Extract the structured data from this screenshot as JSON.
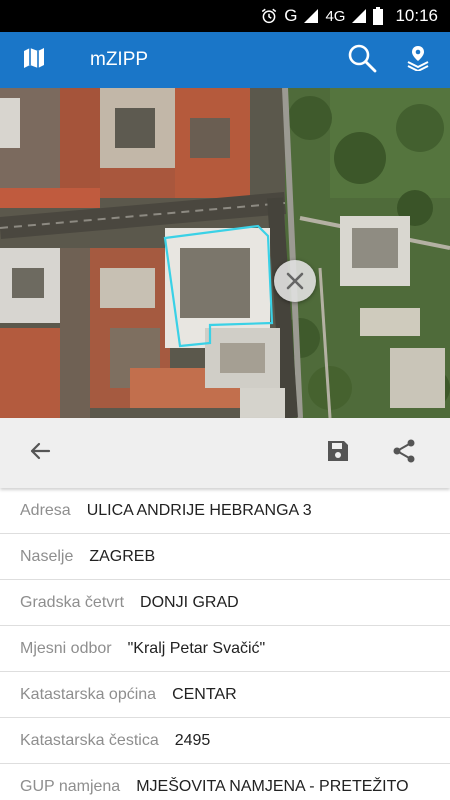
{
  "status_bar": {
    "network_label": "G",
    "network_type": "4G",
    "time": "10:16"
  },
  "app_bar": {
    "title": "mZIPP",
    "color": "#1a76c8",
    "icons": [
      "map-icon",
      "search-icon",
      "location-layers-icon"
    ]
  },
  "map": {
    "highlight_color": "#3ad1e6"
  },
  "toolbar": {
    "icons": [
      "back-arrow-icon",
      "save-icon",
      "share-icon"
    ]
  },
  "details": [
    {
      "label": "Adresa",
      "value": "ULICA ANDRIJE HEBRANGA 3"
    },
    {
      "label": "Naselje",
      "value": "ZAGREB"
    },
    {
      "label": "Gradska četvrt",
      "value": "DONJI GRAD"
    },
    {
      "label": "Mjesni odbor",
      "value": "\"Kralj Petar Svačić\""
    },
    {
      "label": "Katastarska općina",
      "value": "CENTAR"
    },
    {
      "label": "Katastarska čestica",
      "value": "2495"
    },
    {
      "label": "GUP namjena",
      "value": "MJEŠOVITA NAMJENA - PRETEŽITO"
    }
  ]
}
